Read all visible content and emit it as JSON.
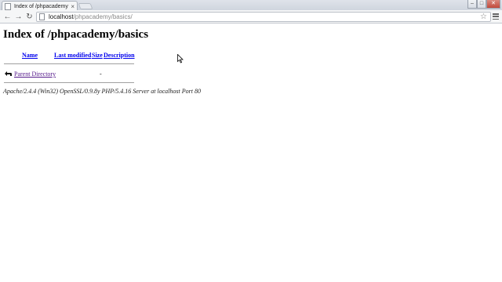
{
  "browser": {
    "tab_title": "Index of /phpacademy/basics/",
    "tab_close": "×",
    "url_host": "localhost",
    "url_path": "/phpacademy/basics/",
    "icons": {
      "back": "arrow-left",
      "forward": "arrow-right",
      "reload": "reload",
      "bookmark": "star",
      "menu": "hamburger"
    }
  },
  "page": {
    "title": "Index of /phpacademy/basics",
    "columns": {
      "name": "Name",
      "last_modified": "Last modified",
      "size": "Size",
      "description": "Description"
    },
    "rows": [
      {
        "name": "Parent Directory",
        "size": "-"
      }
    ],
    "server_signature": "Apache/2.4.4 (Win32) OpenSSL/0.9.8y PHP/5.4.16 Server at localhost Port 80"
  },
  "colors": {
    "link": "#0000ee",
    "visited_link": "#551a8b"
  }
}
